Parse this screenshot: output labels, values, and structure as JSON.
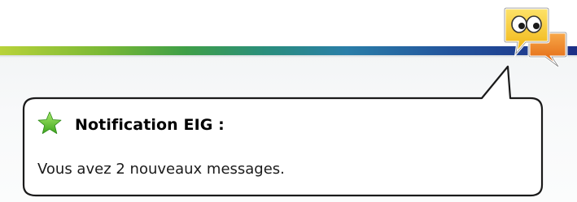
{
  "notification": {
    "title": "Notification EIG :",
    "message": "Vous avez 2 nouveaux messages."
  },
  "icons": {
    "balloon_icon": "star-icon",
    "tray_icon": "chat-bubbles-icon"
  },
  "colors": {
    "bar_start": "#b8d23a",
    "bar_end": "#1c2f86",
    "balloon_border": "#1a1a1a",
    "star": "#6cc83a",
    "bubble_yellow": "#f6c21a",
    "bubble_orange": "#f08a1c"
  }
}
